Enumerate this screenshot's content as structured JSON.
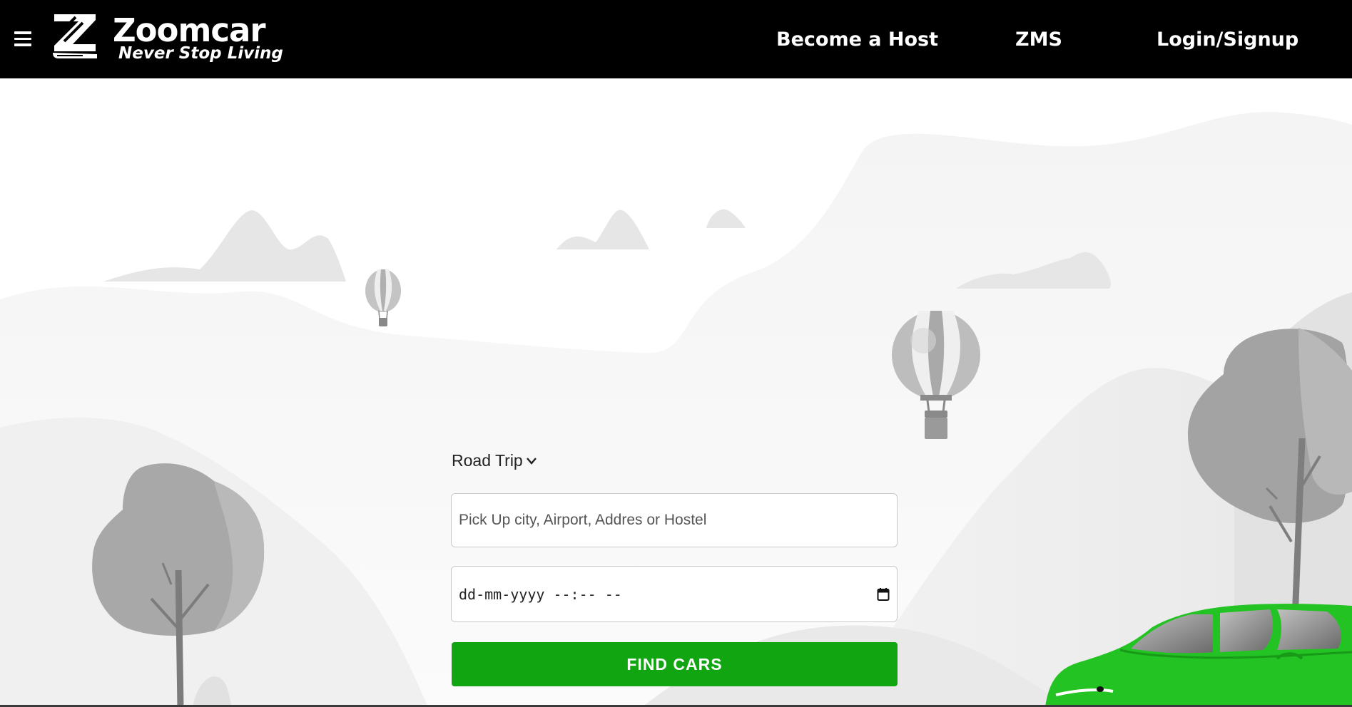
{
  "header": {
    "logo": {
      "name": "Zoomcar",
      "tagline": "Never Stop Living",
      "icon": "zoomcar-z-logo"
    },
    "menu_icon": "hamburger-menu-icon",
    "nav": [
      {
        "label": "Become a Host"
      },
      {
        "label": "ZMS"
      },
      {
        "label": "Login/Signup"
      }
    ],
    "background_color": "#000000"
  },
  "search": {
    "trip_type": {
      "label": "Road Trip",
      "icon": "chevron-down-icon"
    },
    "pickup": {
      "placeholder": "Pick Up city, Airport, Addres or Hostel"
    },
    "datetime": {
      "display": "dd-mm-yyyy --:-- --",
      "icon": "calendar-icon"
    },
    "submit": {
      "label": "FIND CARS",
      "color": "#11a611"
    }
  },
  "colors": {
    "accent": "#11a611",
    "car": "#22c322",
    "illustration_gray": "#9a9a9a"
  }
}
